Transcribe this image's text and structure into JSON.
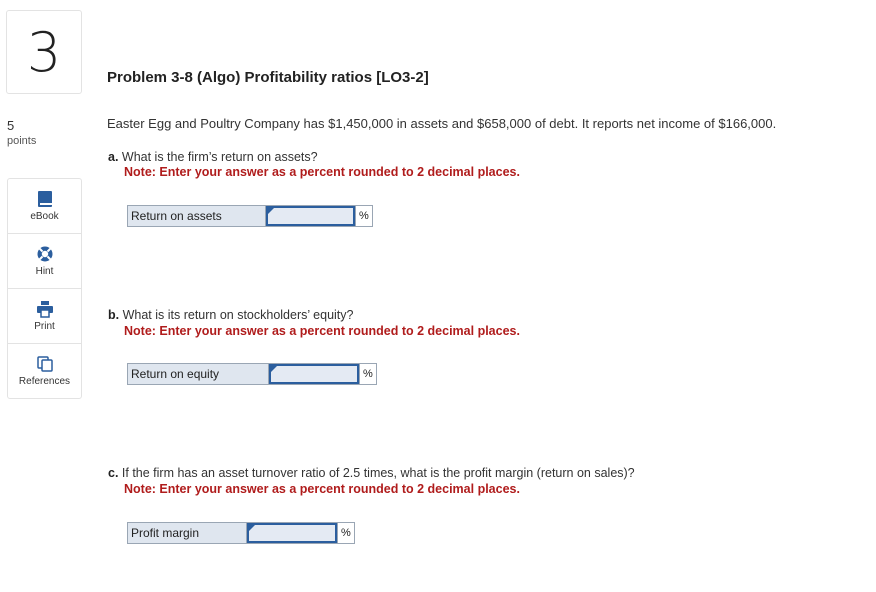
{
  "question": {
    "number": "3",
    "points_value": "5",
    "points_label": "points"
  },
  "tools": [
    {
      "label": "eBook",
      "icon": "book-icon"
    },
    {
      "label": "Hint",
      "icon": "lifebuoy-icon"
    },
    {
      "label": "Print",
      "icon": "printer-icon"
    },
    {
      "label": "References",
      "icon": "copy-icon"
    }
  ],
  "problem": {
    "title": "Problem 3-8 (Algo) Profitability ratios [LO3-2]",
    "intro": "Easter Egg and Poultry Company has $1,450,000 in assets and $658,000 of debt. It reports net income of $166,000."
  },
  "parts": [
    {
      "prefix": "a.",
      "question": " What is the firm’s return on assets?",
      "note": "Note: Enter your answer as a percent rounded to 2 decimal places.",
      "label": "Return on assets",
      "value": "",
      "unit": "%"
    },
    {
      "prefix": "b.",
      "question": " What is its return on stockholders’ equity?",
      "note": "Note: Enter your answer as a percent rounded to 2 decimal places.",
      "label": "Return on equity",
      "value": "",
      "unit": "%"
    },
    {
      "prefix": "c.",
      "question": " If the firm has an asset turnover ratio of 2.5 times, what is the profit margin (return on sales)?",
      "note": "Note: Enter your answer as a percent rounded to 2 decimal places.",
      "label": "Profit margin",
      "value": "",
      "unit": "%"
    }
  ],
  "colors": {
    "note_red": "#b01c1c",
    "input_border": "#2b5e9e"
  }
}
